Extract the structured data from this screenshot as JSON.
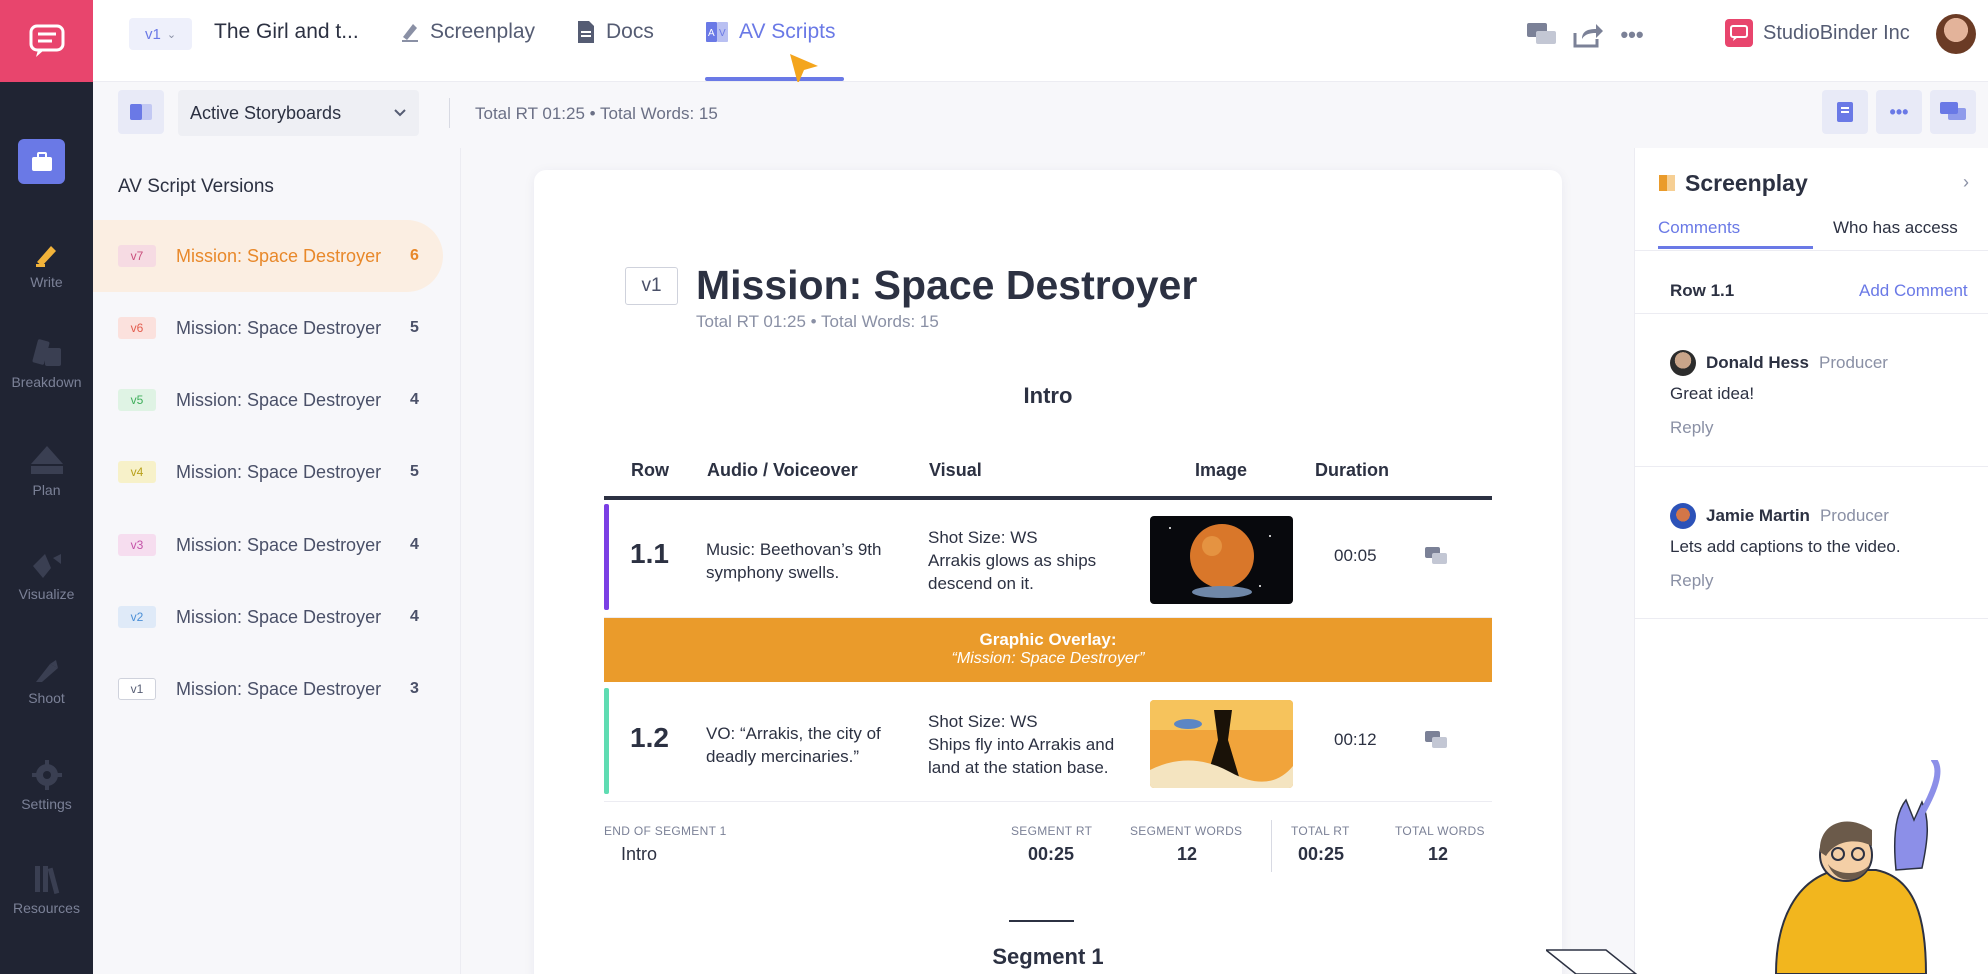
{
  "topbar": {
    "version_label": "v1",
    "project_title": "The Girl and t...",
    "tabs": [
      {
        "label": "Screenplay",
        "icon": "pencil-icon"
      },
      {
        "label": "Docs",
        "icon": "document-icon"
      },
      {
        "label": "AV Scripts",
        "icon": "av-script-icon",
        "active": true
      }
    ],
    "company": "StudioBinder Inc"
  },
  "rail": {
    "items": [
      {
        "label": "Write",
        "icon": "pencil-icon"
      },
      {
        "label": "Breakdown",
        "icon": "breakdown-icon"
      },
      {
        "label": "Plan",
        "icon": "plan-icon"
      },
      {
        "label": "Visualize",
        "icon": "visualize-icon"
      },
      {
        "label": "Shoot",
        "icon": "shoot-icon"
      },
      {
        "label": "Settings",
        "icon": "gear-icon"
      },
      {
        "label": "Resources",
        "icon": "resources-icon"
      }
    ]
  },
  "toolbar": {
    "select_value": "Active Storyboards",
    "totals": "Total RT 01:25 • Total Words: 15"
  },
  "versions": {
    "heading": "AV Script Versions",
    "items": [
      {
        "badge": "v7",
        "name": "Mission: Space Destroyer",
        "count": "6",
        "color": "#c94f7c",
        "bg": "#f6dbe3"
      },
      {
        "badge": "v6",
        "name": "Mission: Space Destroyer",
        "count": "5",
        "color": "#e35d4f",
        "bg": "#fbe1dd"
      },
      {
        "badge": "v5",
        "name": "Mission: Space Destroyer",
        "count": "4",
        "color": "#3fae5b",
        "bg": "#dff3e4"
      },
      {
        "badge": "v4",
        "name": "Mission: Space Destroyer",
        "count": "5",
        "color": "#b8a11c",
        "bg": "#f7f1c9"
      },
      {
        "badge": "v3",
        "name": "Mission: Space Destroyer",
        "count": "4",
        "color": "#c452a8",
        "bg": "#f6ddef"
      },
      {
        "badge": "v2",
        "name": "Mission: Space Destroyer",
        "count": "4",
        "color": "#4b8fd6",
        "bg": "#dfeaf8"
      },
      {
        "badge": "v1",
        "name": "Mission: Space Destroyer",
        "count": "3",
        "color": "#555c73",
        "bg": "#ffffff"
      }
    ]
  },
  "document": {
    "version": "v1",
    "title": "Mission: Space Destroyer",
    "subtitle": "Total RT 01:25 • Total Words: 15",
    "segment_title": "Intro",
    "headers": {
      "row": "Row",
      "audio": "Audio / Voiceover",
      "visual": "Visual",
      "image": "Image",
      "duration": "Duration"
    },
    "rows": [
      {
        "num": "1.1",
        "audio": "Music: Beethovan’s 9th symphony swells.",
        "visual_line1": "Shot Size: WS",
        "visual_line2": "Arrakis glows as ships descend on it.",
        "duration": "00:05",
        "bar_color": "#7b3fe4"
      },
      {
        "num": "1.2",
        "audio": "VO: “Arrakis, the city of deadly mercinaries.”",
        "visual_line1": "Shot Size: WS",
        "visual_line2": "Ships fly into Arrakis and land at the station base.",
        "duration": "00:12",
        "bar_color": "#5fdcb2"
      }
    ],
    "overlay_title": "Graphic Overlay:",
    "overlay_text": "“Mission: Space Destroyer”",
    "end": {
      "label": "END OF SEGMENT 1",
      "name": "Intro",
      "segment_rt_label": "SEGMENT RT",
      "segment_rt": "00:25",
      "segment_words_label": "SEGMENT WORDS",
      "segment_words": "12",
      "total_rt_label": "TOTAL RT",
      "total_rt": "00:25",
      "total_words_label": "TOTAL WORDS",
      "total_words": "12"
    },
    "next_segment": "Segment 1"
  },
  "panel": {
    "title": "Screenplay",
    "tab_comments": "Comments",
    "tab_access": "Who has access",
    "row_label": "Row 1.1",
    "add_comment": "Add Comment",
    "comments": [
      {
        "name": "Donald Hess",
        "role": "Producer",
        "text": "Great idea!",
        "reply": "Reply"
      },
      {
        "name": "Jamie Martin",
        "role": "Producer",
        "text": "Lets add captions to the video.",
        "reply": "Reply"
      }
    ]
  },
  "colors": {
    "accent": "#6a79e6",
    "brand": "#e8456d",
    "overlay": "#ea9b2b"
  }
}
